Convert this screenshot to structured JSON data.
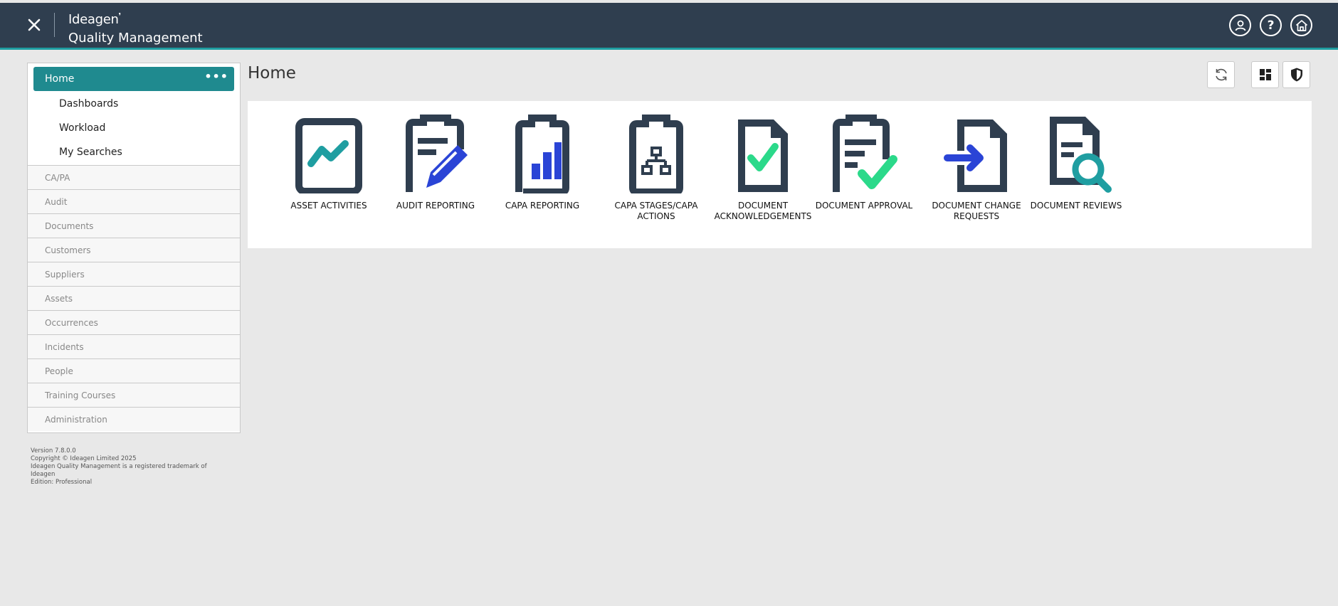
{
  "header": {
    "brand_logo": "Ideagen",
    "product_name": "Quality Management",
    "close_symbol": "✕",
    "accent_color": "#1f9ea1",
    "background_color": "#2f3e4f"
  },
  "sidebar": {
    "home_label": "Home",
    "home_more": "•••",
    "subitems": [
      "Dashboards",
      "Workload",
      "My Searches"
    ],
    "modules": [
      "CA/PA",
      "Audit",
      "Documents",
      "Customers",
      "Suppliers",
      "Assets",
      "Occurrences",
      "Incidents",
      "People",
      "Training Courses",
      "Administration"
    ]
  },
  "version_info": {
    "version": "Version 7.8.0.0",
    "copyright": "Copyright © Ideagen Limited 2025",
    "trademark": "Ideagen Quality Management is a registered trademark of Ideagen",
    "edition": "Edition: Professional"
  },
  "main": {
    "title": "Home",
    "tiles": [
      {
        "label": "ASSET ACTIVITIES",
        "icon": "asset-activities-icon"
      },
      {
        "label": "AUDIT REPORTING",
        "icon": "audit-reporting-icon"
      },
      {
        "label": "CAPA REPORTING",
        "icon": "capa-reporting-icon"
      },
      {
        "label": "CAPA STAGES/CAPA ACTIONS",
        "icon": "capa-stages-icon"
      },
      {
        "label": "DOCUMENT ACKNOWLEDGEMENTS",
        "icon": "document-acknowledgements-icon"
      },
      {
        "label": "DOCUMENT APPROVAL",
        "icon": "document-approval-icon"
      },
      {
        "label": "DOCUMENT CHANGE REQUESTS",
        "icon": "document-change-requests-icon"
      },
      {
        "label": "DOCUMENT REVIEWS",
        "icon": "document-reviews-icon"
      }
    ]
  },
  "colors": {
    "icon_dark": "#2f3e4f",
    "icon_teal": "#1f9ea1",
    "icon_blue": "#2a44d6",
    "icon_green": "#2bd98a",
    "sidebar_active": "#1f8a8f"
  }
}
